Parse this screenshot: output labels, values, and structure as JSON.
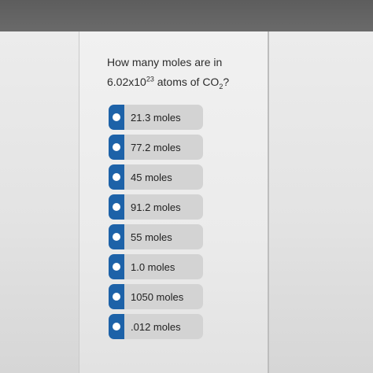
{
  "question": {
    "line1": "How many moles are in",
    "base": "6.02x10",
    "exponent": "23",
    "middle": " atoms of CO",
    "subscript": "2",
    "end": "?"
  },
  "options": [
    {
      "label": "21.3 moles"
    },
    {
      "label": "77.2 moles"
    },
    {
      "label": "45 moles"
    },
    {
      "label": "91.2 moles"
    },
    {
      "label": "55 moles"
    },
    {
      "label": "1.0 moles"
    },
    {
      "label": "1050 moles"
    },
    {
      "label": ".012 moles"
    }
  ],
  "colors": {
    "radio_tab": "#1d62a8",
    "option_bg": "#d3d3d3",
    "top_bar": "#636363"
  }
}
